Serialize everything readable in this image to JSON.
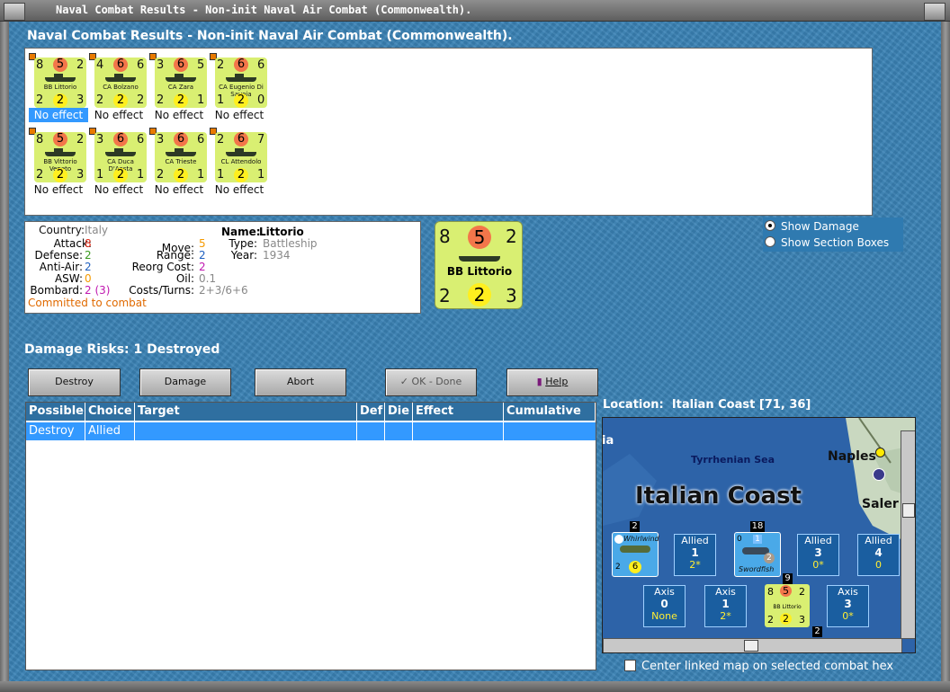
{
  "window": {
    "title": "Naval Combat Results - Non-init Naval Air Combat (Commonwealth)."
  },
  "heading": "Naval Combat Results - Non-init Naval Air Combat (Commonwealth).",
  "units": [
    {
      "tl": "8",
      "tc": "5",
      "tr": "2",
      "bl": "2",
      "bc": "2",
      "br": "3",
      "name": "BB Littorio",
      "result": "No effect",
      "selected": true
    },
    {
      "tl": "4",
      "tc": "6",
      "tr": "6",
      "bl": "2",
      "bc": "2",
      "br": "2",
      "name": "CA Bolzano",
      "result": "No effect",
      "selected": false
    },
    {
      "tl": "3",
      "tc": "6",
      "tr": "5",
      "bl": "2",
      "bc": "2",
      "br": "1",
      "name": "CA Zara",
      "result": "No effect",
      "selected": false
    },
    {
      "tl": "2",
      "tc": "6",
      "tr": "6",
      "bl": "1",
      "bc": "2",
      "br": "0",
      "name": "CA Eugenio Di Savoia",
      "result": "No effect",
      "selected": false
    },
    {
      "tl": "8",
      "tc": "5",
      "tr": "2",
      "bl": "2",
      "bc": "2",
      "br": "3",
      "name": "BB Vittorio Veneto",
      "result": "No effect",
      "selected": false
    },
    {
      "tl": "3",
      "tc": "6",
      "tr": "6",
      "bl": "1",
      "bc": "2",
      "br": "1",
      "name": "CA Duca D'Aosta",
      "result": "No effect",
      "selected": false
    },
    {
      "tl": "3",
      "tc": "6",
      "tr": "6",
      "bl": "2",
      "bc": "2",
      "br": "1",
      "name": "CA Trieste",
      "result": "No effect",
      "selected": false
    },
    {
      "tl": "2",
      "tc": "6",
      "tr": "7",
      "bl": "1",
      "bc": "2",
      "br": "1",
      "name": "CL Attendolo",
      "result": "No effect",
      "selected": false
    }
  ],
  "info": {
    "country_label": "Country:",
    "country": "Italy",
    "attack_label": "Attack:",
    "attack": "8",
    "defense_label": "Defense:",
    "defense": "2",
    "antiair_label": "Anti-Air:",
    "antiair": "2",
    "asw_label": "ASW:",
    "asw": "0",
    "bombard_label": "Bombard:",
    "bombard": "2 (3)",
    "status": "Committed to combat",
    "name_label": "Name:",
    "name": "Littorio",
    "type_label": "Type:",
    "type": "Battleship",
    "year_label": "Year:",
    "year": "1934",
    "move_label": "Move:",
    "move": "5",
    "range_label": "Range:",
    "range": "2",
    "reorg_label": "Reorg Cost:",
    "reorg": "2",
    "oil_label": "Oil:",
    "oil": "0.1",
    "costs_label": "Costs/Turns:",
    "costs": "2+3/6+6"
  },
  "big_counter": {
    "tl": "8",
    "tc": "5",
    "tr": "2",
    "bl": "2",
    "bc": "2",
    "br": "3",
    "name": "BB Littorio"
  },
  "display_options": {
    "show_damage": "Show Damage",
    "show_sections": "Show Section Boxes",
    "selected": "show_damage"
  },
  "damage_risks": "Damage Risks: 1 Destroyed",
  "buttons": {
    "destroy": "Destroy",
    "damage": "Damage",
    "abort": "Abort",
    "ok": "OK - Done",
    "help": "Help"
  },
  "table": {
    "headers": [
      "Possible",
      "Choice",
      "Target",
      "Def",
      "Die",
      "Effect",
      "Cumulative"
    ],
    "rows": [
      [
        "Destroy",
        "Allied",
        "",
        "",
        "",
        "",
        ""
      ]
    ]
  },
  "location": {
    "label": "Location:",
    "value": "Italian Coast [71, 36]"
  },
  "map": {
    "sea": "Tyrrhenian Sea",
    "region": "Italian Coast",
    "city1": "Naples",
    "city2": "Saler",
    "edge": "ia",
    "allied_boxes": [
      {
        "side": "Allied",
        "n": "1",
        "v": "2*"
      },
      {
        "side": "Allied",
        "n": "3",
        "v": "0*"
      },
      {
        "side": "Allied",
        "n": "4",
        "v": "0"
      }
    ],
    "axis_boxes": [
      {
        "side": "Axis",
        "n": "0",
        "v": "None"
      },
      {
        "side": "Axis",
        "n": "1",
        "v": "2*"
      },
      {
        "side": "Axis",
        "n": "3",
        "v": "0*"
      }
    ],
    "stack1": "2",
    "stack2": "18",
    "stack3": "9",
    "stack4": "2",
    "plane1": "Whirlwind",
    "plane1_val": "6",
    "plane1_l": "2",
    "plane2": "Swordfish",
    "plane2_val": "2",
    "plane2_top": "1",
    "plane2_left": "0",
    "map_counter": {
      "tl": "8",
      "tc": "5",
      "tr": "2",
      "bl": "2",
      "bc": "2",
      "br": "3",
      "name": "BB Littorio"
    }
  },
  "center_checkbox": "Center linked map on selected combat hex"
}
